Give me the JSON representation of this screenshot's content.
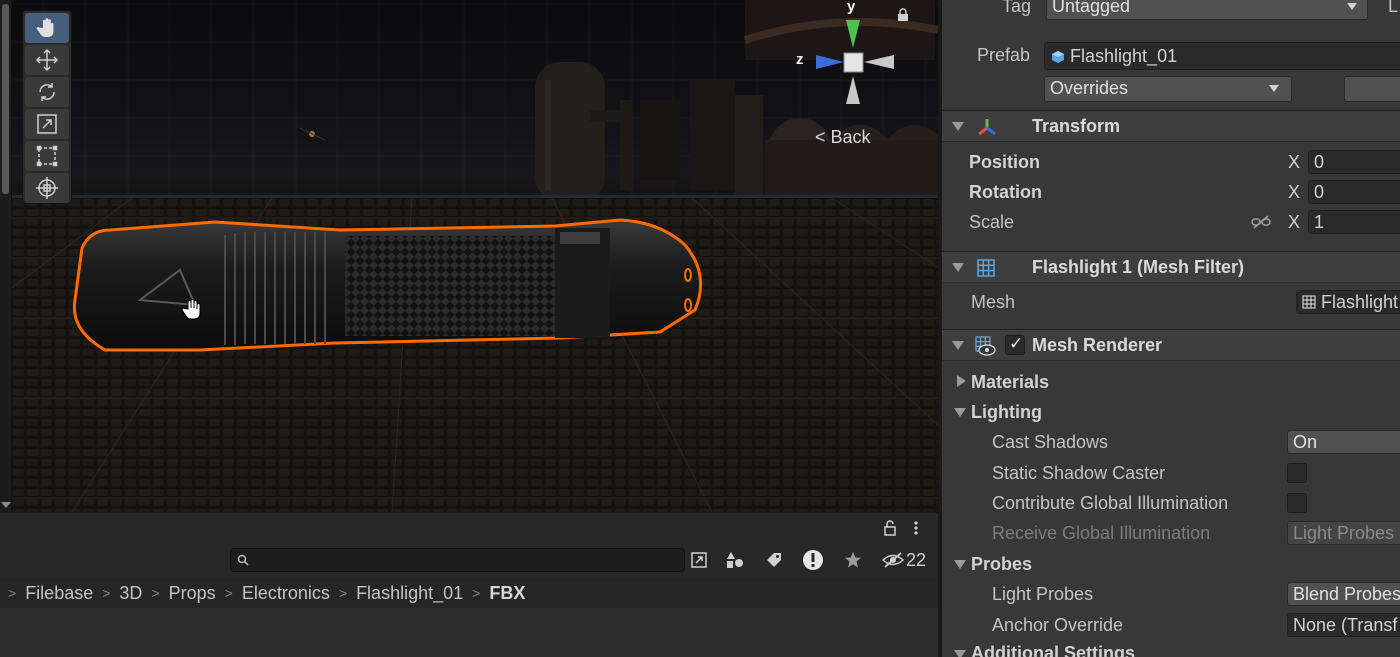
{
  "scene": {
    "back_label": "< Back",
    "gizmo": {
      "y_label": "y",
      "z_label": "z"
    },
    "tools": [
      "hand-tool",
      "move-tool",
      "rotate-tool",
      "scale-tool",
      "rect-tool",
      "transform-tool"
    ]
  },
  "project": {
    "search_placeholder": "",
    "hidden_count": "22",
    "breadcrumb": [
      "Filebase",
      "3D",
      "Props",
      "Electronics",
      "Flashlight_01",
      "FBX"
    ]
  },
  "inspector": {
    "tag_label": "Tag",
    "tag_value": "Untagged",
    "layer_label_partial": "L",
    "prefab_label": "Prefab",
    "prefab_value": "Flashlight_01",
    "overrides_label": "Overrides",
    "transform": {
      "title": "Transform",
      "position_label": "Position",
      "rotation_label": "Rotation",
      "scale_label": "Scale",
      "x_label": "X",
      "position_x": "0",
      "rotation_x": "0",
      "scale_x": "1"
    },
    "mesh_filter": {
      "title": "Flashlight 1 (Mesh Filter)",
      "mesh_label": "Mesh",
      "mesh_value": "Flashlight"
    },
    "mesh_renderer": {
      "title": "Mesh Renderer",
      "enabled": true,
      "materials_label": "Materials",
      "lighting_label": "Lighting",
      "cast_shadows_label": "Cast Shadows",
      "cast_shadows_value": "On",
      "static_shadow_caster_label": "Static Shadow Caster",
      "contribute_gi_label": "Contribute Global Illumination",
      "receive_gi_label": "Receive Global Illumination",
      "receive_gi_value": "Light Probes",
      "probes_label": "Probes",
      "light_probes_label": "Light Probes",
      "light_probes_value": "Blend Probes",
      "anchor_override_label": "Anchor Override",
      "anchor_override_value": "None (Transf",
      "additional_settings_label": "Additional Settings"
    }
  },
  "colors": {
    "accent_selection": "#ff6a00",
    "active_tool": "#46607c",
    "gizmo_y": "#4ec24e",
    "gizmo_z": "#3d6bdc"
  }
}
